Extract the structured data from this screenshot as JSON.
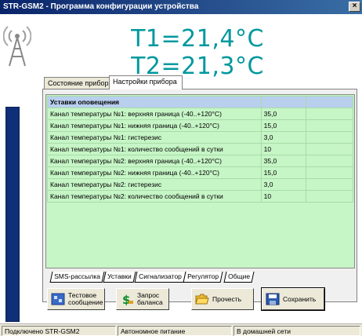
{
  "window": {
    "title": "STR-GSM2 - Программа конфигурации устройства",
    "close_glyph": "×"
  },
  "header": {
    "temperature_display": "T1=21,4°C T2=21,3°C"
  },
  "tabs_top": [
    "Состояние прибора",
    "Настройки прибора"
  ],
  "grid": {
    "header": "Уставки оповещения",
    "rows": [
      {
        "name": "Канал температуры №1: верхняя граница (-40..+120°C)",
        "value": "35,0"
      },
      {
        "name": "Канал температуры №1: нижняя граница (-40..+120°C)",
        "value": "15,0"
      },
      {
        "name": "Канал температуры №1: гистерезис",
        "value": "3,0"
      },
      {
        "name": "Канал температуры №1: количество сообщений в сутки",
        "value": "10"
      },
      {
        "name": "Канал температуры №2: верхняя граница (-40..+120°C)",
        "value": "35,0"
      },
      {
        "name": "Канал температуры №2: нижняя граница (-40..+120°C)",
        "value": "15,0"
      },
      {
        "name": "Канал температуры №2: гистерезис",
        "value": "3,0"
      },
      {
        "name": "Канал температуры №2: количество сообщений в сутки",
        "value": "10"
      }
    ]
  },
  "tabs_bottom": [
    "SMS-рассылка",
    "Уставки",
    "Сигнализатор",
    "Регулятор",
    "Общие"
  ],
  "buttons": {
    "test_line1": "Тестовое",
    "test_line2": "сообщение",
    "balance_line1": "Запрос",
    "balance_line2": "баланса",
    "read": "Прочесть",
    "save": "Сохранить"
  },
  "status": {
    "connection": "Подключено STR-GSM2",
    "power": "Автономное питание",
    "network": "В домашней сети"
  },
  "colors": {
    "temperature": "#00989e",
    "grid_bg": "#c6f5c6",
    "grid_header": "#b9cfee",
    "titlebar": "#0a246a"
  }
}
